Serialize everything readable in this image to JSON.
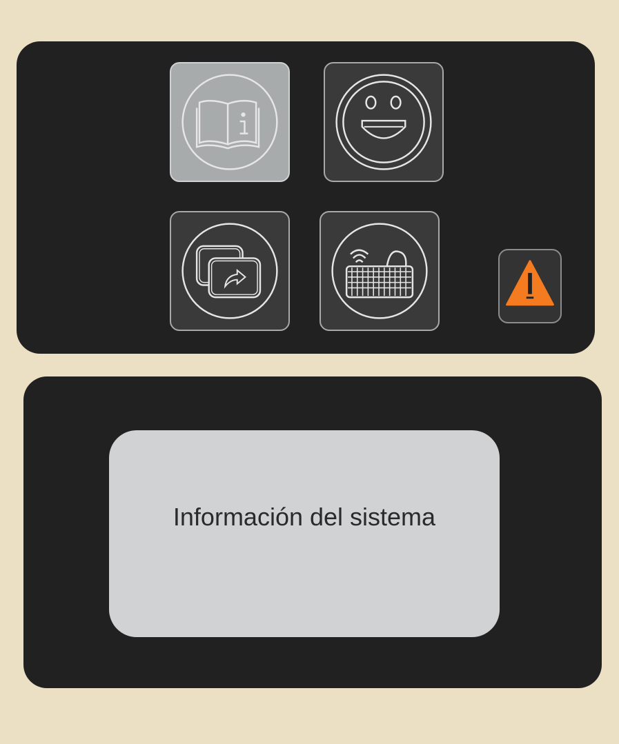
{
  "menu": {
    "tiles": [
      {
        "name": "system-info",
        "icon": "book-info-icon",
        "state": "selected"
      },
      {
        "name": "feedback",
        "icon": "smiley-icon"
      },
      {
        "name": "screen-switch",
        "icon": "screen-share-icon"
      },
      {
        "name": "wireless-keyboard",
        "icon": "wireless-keyboard-icon"
      }
    ],
    "warning": {
      "icon": "warning-triangle-icon",
      "color": "#f47b20"
    }
  },
  "display": {
    "label": "Información del sistema"
  },
  "colors": {
    "background": "#ebdfc4",
    "panel": "#222122",
    "tile": "#3b3a3b",
    "tile_selected": "#a8abac",
    "display_box": "#d1d2d4"
  }
}
